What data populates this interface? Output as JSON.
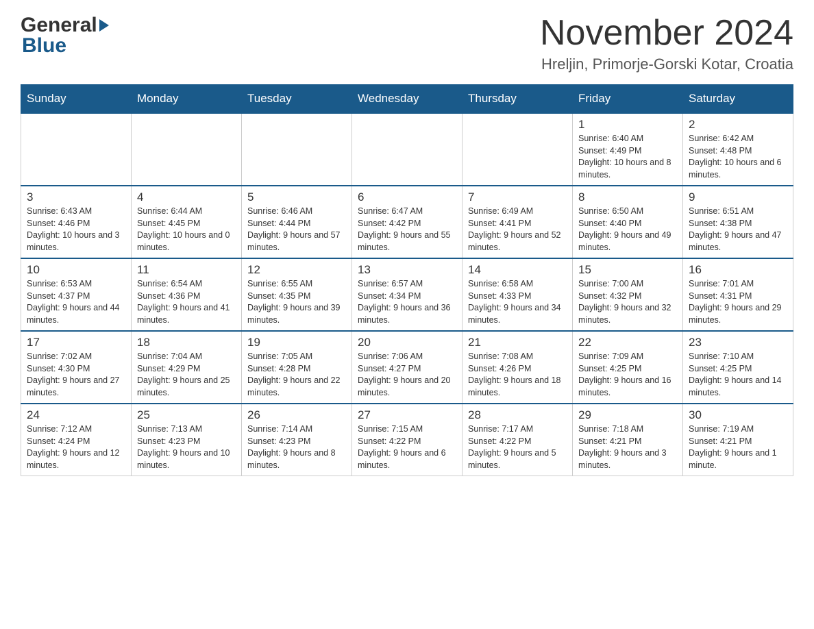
{
  "header": {
    "logo_general": "General",
    "logo_blue": "Blue",
    "month_title": "November 2024",
    "location": "Hreljin, Primorje-Gorski Kotar, Croatia"
  },
  "calendar": {
    "days_of_week": [
      "Sunday",
      "Monday",
      "Tuesday",
      "Wednesday",
      "Thursday",
      "Friday",
      "Saturday"
    ],
    "weeks": [
      [
        {
          "day": "",
          "info": ""
        },
        {
          "day": "",
          "info": ""
        },
        {
          "day": "",
          "info": ""
        },
        {
          "day": "",
          "info": ""
        },
        {
          "day": "",
          "info": ""
        },
        {
          "day": "1",
          "info": "Sunrise: 6:40 AM\nSunset: 4:49 PM\nDaylight: 10 hours and 8 minutes."
        },
        {
          "day": "2",
          "info": "Sunrise: 6:42 AM\nSunset: 4:48 PM\nDaylight: 10 hours and 6 minutes."
        }
      ],
      [
        {
          "day": "3",
          "info": "Sunrise: 6:43 AM\nSunset: 4:46 PM\nDaylight: 10 hours and 3 minutes."
        },
        {
          "day": "4",
          "info": "Sunrise: 6:44 AM\nSunset: 4:45 PM\nDaylight: 10 hours and 0 minutes."
        },
        {
          "day": "5",
          "info": "Sunrise: 6:46 AM\nSunset: 4:44 PM\nDaylight: 9 hours and 57 minutes."
        },
        {
          "day": "6",
          "info": "Sunrise: 6:47 AM\nSunset: 4:42 PM\nDaylight: 9 hours and 55 minutes."
        },
        {
          "day": "7",
          "info": "Sunrise: 6:49 AM\nSunset: 4:41 PM\nDaylight: 9 hours and 52 minutes."
        },
        {
          "day": "8",
          "info": "Sunrise: 6:50 AM\nSunset: 4:40 PM\nDaylight: 9 hours and 49 minutes."
        },
        {
          "day": "9",
          "info": "Sunrise: 6:51 AM\nSunset: 4:38 PM\nDaylight: 9 hours and 47 minutes."
        }
      ],
      [
        {
          "day": "10",
          "info": "Sunrise: 6:53 AM\nSunset: 4:37 PM\nDaylight: 9 hours and 44 minutes."
        },
        {
          "day": "11",
          "info": "Sunrise: 6:54 AM\nSunset: 4:36 PM\nDaylight: 9 hours and 41 minutes."
        },
        {
          "day": "12",
          "info": "Sunrise: 6:55 AM\nSunset: 4:35 PM\nDaylight: 9 hours and 39 minutes."
        },
        {
          "day": "13",
          "info": "Sunrise: 6:57 AM\nSunset: 4:34 PM\nDaylight: 9 hours and 36 minutes."
        },
        {
          "day": "14",
          "info": "Sunrise: 6:58 AM\nSunset: 4:33 PM\nDaylight: 9 hours and 34 minutes."
        },
        {
          "day": "15",
          "info": "Sunrise: 7:00 AM\nSunset: 4:32 PM\nDaylight: 9 hours and 32 minutes."
        },
        {
          "day": "16",
          "info": "Sunrise: 7:01 AM\nSunset: 4:31 PM\nDaylight: 9 hours and 29 minutes."
        }
      ],
      [
        {
          "day": "17",
          "info": "Sunrise: 7:02 AM\nSunset: 4:30 PM\nDaylight: 9 hours and 27 minutes."
        },
        {
          "day": "18",
          "info": "Sunrise: 7:04 AM\nSunset: 4:29 PM\nDaylight: 9 hours and 25 minutes."
        },
        {
          "day": "19",
          "info": "Sunrise: 7:05 AM\nSunset: 4:28 PM\nDaylight: 9 hours and 22 minutes."
        },
        {
          "day": "20",
          "info": "Sunrise: 7:06 AM\nSunset: 4:27 PM\nDaylight: 9 hours and 20 minutes."
        },
        {
          "day": "21",
          "info": "Sunrise: 7:08 AM\nSunset: 4:26 PM\nDaylight: 9 hours and 18 minutes."
        },
        {
          "day": "22",
          "info": "Sunrise: 7:09 AM\nSunset: 4:25 PM\nDaylight: 9 hours and 16 minutes."
        },
        {
          "day": "23",
          "info": "Sunrise: 7:10 AM\nSunset: 4:25 PM\nDaylight: 9 hours and 14 minutes."
        }
      ],
      [
        {
          "day": "24",
          "info": "Sunrise: 7:12 AM\nSunset: 4:24 PM\nDaylight: 9 hours and 12 minutes."
        },
        {
          "day": "25",
          "info": "Sunrise: 7:13 AM\nSunset: 4:23 PM\nDaylight: 9 hours and 10 minutes."
        },
        {
          "day": "26",
          "info": "Sunrise: 7:14 AM\nSunset: 4:23 PM\nDaylight: 9 hours and 8 minutes."
        },
        {
          "day": "27",
          "info": "Sunrise: 7:15 AM\nSunset: 4:22 PM\nDaylight: 9 hours and 6 minutes."
        },
        {
          "day": "28",
          "info": "Sunrise: 7:17 AM\nSunset: 4:22 PM\nDaylight: 9 hours and 5 minutes."
        },
        {
          "day": "29",
          "info": "Sunrise: 7:18 AM\nSunset: 4:21 PM\nDaylight: 9 hours and 3 minutes."
        },
        {
          "day": "30",
          "info": "Sunrise: 7:19 AM\nSunset: 4:21 PM\nDaylight: 9 hours and 1 minute."
        }
      ]
    ]
  }
}
